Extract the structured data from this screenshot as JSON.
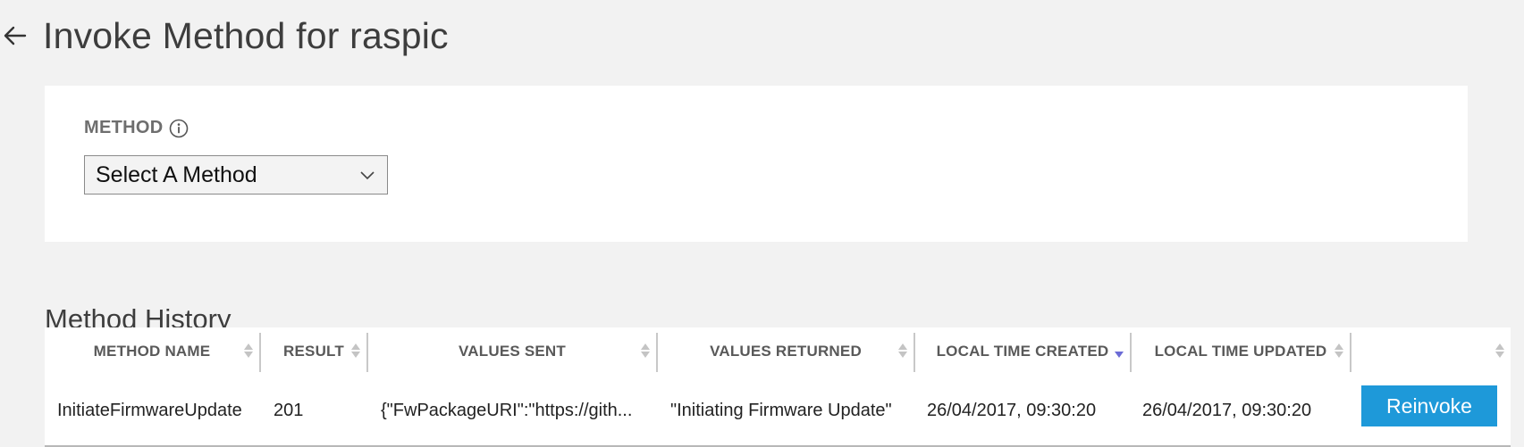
{
  "header": {
    "title": "Invoke Method for raspic"
  },
  "method_card": {
    "label": "METHOD",
    "select": {
      "value": "Select A Method"
    }
  },
  "history": {
    "title": "Method History",
    "columns": [
      {
        "label": "METHOD NAME",
        "sort": "none"
      },
      {
        "label": "RESULT",
        "sort": "none"
      },
      {
        "label": "VALUES SENT",
        "sort": "none"
      },
      {
        "label": "VALUES RETURNED",
        "sort": "none"
      },
      {
        "label": "LOCAL TIME CREATED",
        "sort": "descending"
      },
      {
        "label": "LOCAL TIME UPDATED",
        "sort": "none"
      },
      {
        "label": "",
        "sort": "none"
      }
    ],
    "rows": [
      {
        "method_name": "InitiateFirmwareUpdate",
        "result": "201",
        "values_sent": "{\"FwPackageURI\":\"https://gith...",
        "values_returned": "\"Initiating Firmware Update\"",
        "time_created": "26/04/2017, 09:30:20",
        "time_updated": "26/04/2017, 09:30:20",
        "action_label": "Reinvoke"
      }
    ]
  },
  "colors": {
    "accent": "#1e99d9",
    "background": "#f2f2f2",
    "sort_active": "#6b6bd6"
  }
}
